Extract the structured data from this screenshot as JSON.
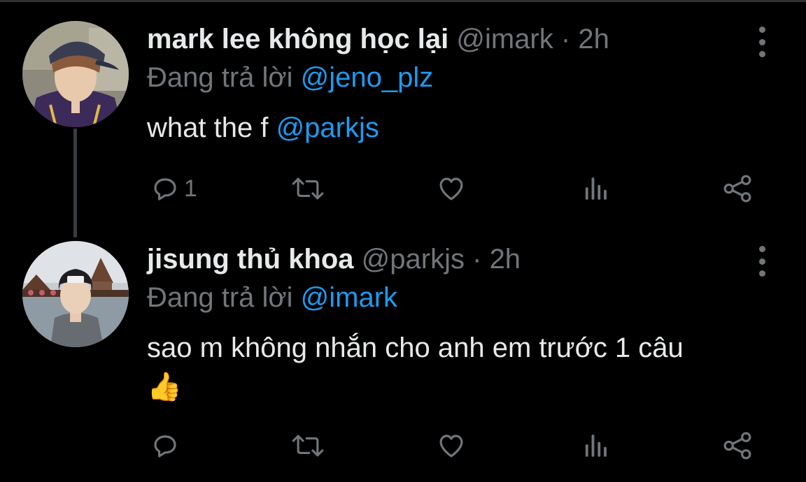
{
  "tweets": [
    {
      "name": "mark lee không học lại",
      "handle": "@imark",
      "dot": "·",
      "time": "2h",
      "reply_prefix": "Đang trả lời ",
      "reply_to": "@jeno_plz",
      "body_text": "what the f ",
      "body_mention": "@parkjs",
      "reply_count": "1"
    },
    {
      "name": "jisung thủ khoa",
      "handle": "@parkjs",
      "dot": "·",
      "time": "2h",
      "reply_prefix": "Đang trả lời ",
      "reply_to": "@imark",
      "body_text": "sao m không nhắn cho anh em trước 1 câu",
      "emoji": "👍",
      "reply_count": ""
    }
  ],
  "icons": [
    "reply-icon",
    "retweet-icon",
    "like-icon",
    "views-icon",
    "share-icon",
    "more-icon"
  ],
  "colors": {
    "background": "#000000",
    "text": "#e7e9ea",
    "muted": "#71767b",
    "link": "#1d9bf0"
  }
}
